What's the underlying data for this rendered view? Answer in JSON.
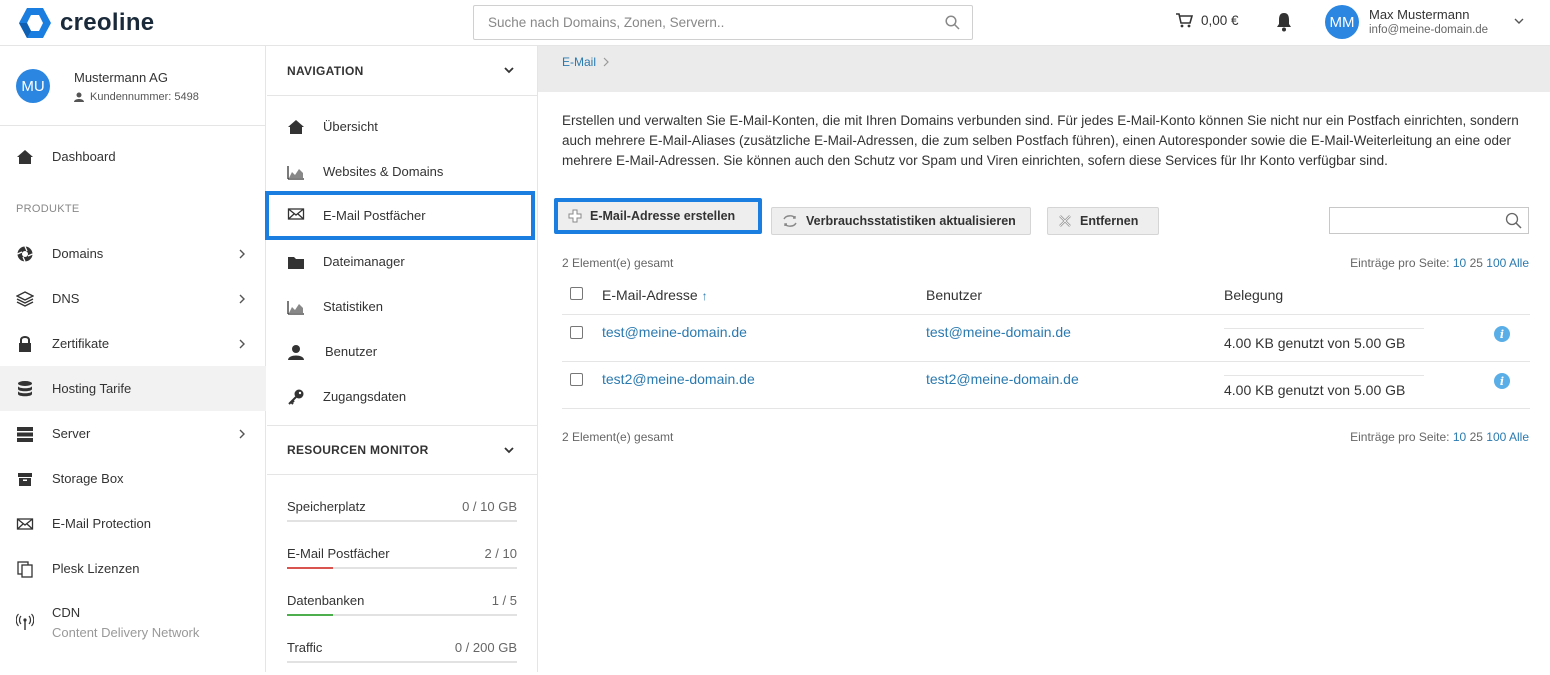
{
  "header": {
    "logo_text": "creoline",
    "search_placeholder": "Suche nach Domains, Zonen, Servern..",
    "cart_amount": "0,00 €",
    "user_initials": "MM",
    "user_name": "Max Mustermann",
    "user_email": "info@meine-domain.de"
  },
  "customer": {
    "initials": "MU",
    "name": "Mustermann AG",
    "number": "Kundennummer: 5498"
  },
  "sidebar": {
    "dashboard": "Dashboard",
    "section_products": "PRODUKTE",
    "items": [
      {
        "label": "Domains"
      },
      {
        "label": "DNS"
      },
      {
        "label": "Zertifikate"
      },
      {
        "label": "Hosting Tarife"
      },
      {
        "label": "Server"
      },
      {
        "label": "Storage Box"
      },
      {
        "label": "E-Mail Protection"
      },
      {
        "label": "Plesk Lizenzen"
      },
      {
        "label": "CDN",
        "sub": "Content Delivery Network"
      }
    ]
  },
  "navigation": {
    "title": "NAVIGATION",
    "items": [
      {
        "label": "Übersicht"
      },
      {
        "label": "Websites & Domains"
      },
      {
        "label": "E-Mail Postfächer"
      },
      {
        "label": "Dateimanager"
      },
      {
        "label": "Statistiken"
      },
      {
        "label": "Benutzer"
      },
      {
        "label": "Zugangsdaten"
      }
    ]
  },
  "resources": {
    "title": "RESOURCEN MONITOR",
    "items": [
      {
        "label": "Speicherplatz",
        "value": "0 / 10 GB",
        "fraction": 0.0,
        "color": "#d9534f"
      },
      {
        "label": "E-Mail Postfächer",
        "value": "2 / 10",
        "fraction": 0.2,
        "color": "#d9534f"
      },
      {
        "label": "Datenbanken",
        "value": "1 / 5",
        "fraction": 0.2,
        "color": "#4cae4c"
      },
      {
        "label": "Traffic",
        "value": "0 / 200 GB",
        "fraction": 0.0,
        "color": "#d9534f"
      }
    ]
  },
  "main": {
    "breadcrumb": "E-Mail",
    "description": "Erstellen und verwalten Sie E-Mail-Konten, die mit Ihren Domains verbunden sind. Für jedes E-Mail-Konto können Sie nicht nur ein Postfach einrichten, sondern auch mehrere E-Mail-Aliases (zusätzliche E-Mail-Adressen, die zum selben Postfach führen), einen Autoresponder sowie die E-Mail-Weiterleitung an eine oder mehrere E-Mail-Adressen. Sie können auch den Schutz vor Spam und Viren einrichten, sofern diese Services für Ihr Konto verfügbar sind.",
    "btn_create": "E-Mail-Adresse erstellen",
    "btn_stats": "Verbrauchsstatistiken aktualisieren",
    "btn_remove": "Entfernen",
    "total": "2 Element(e) gesamt",
    "per_page_label": "Einträge pro Seite:",
    "per_page_10": "10",
    "per_page_25": "25",
    "per_page_100": "100",
    "per_page_all": "Alle",
    "col_email": "E-Mail-Adresse",
    "col_email_sort": "↑",
    "col_user": "Benutzer",
    "col_usage": "Belegung",
    "rows": [
      {
        "email": "test@meine-domain.de",
        "user": "test@meine-domain.de",
        "usage": "4.00 KB genutzt von 5.00 GB"
      },
      {
        "email": "test2@meine-domain.de",
        "user": "test2@meine-domain.de",
        "usage": "4.00 KB genutzt von 5.00 GB"
      }
    ],
    "info_glyph": "i"
  }
}
